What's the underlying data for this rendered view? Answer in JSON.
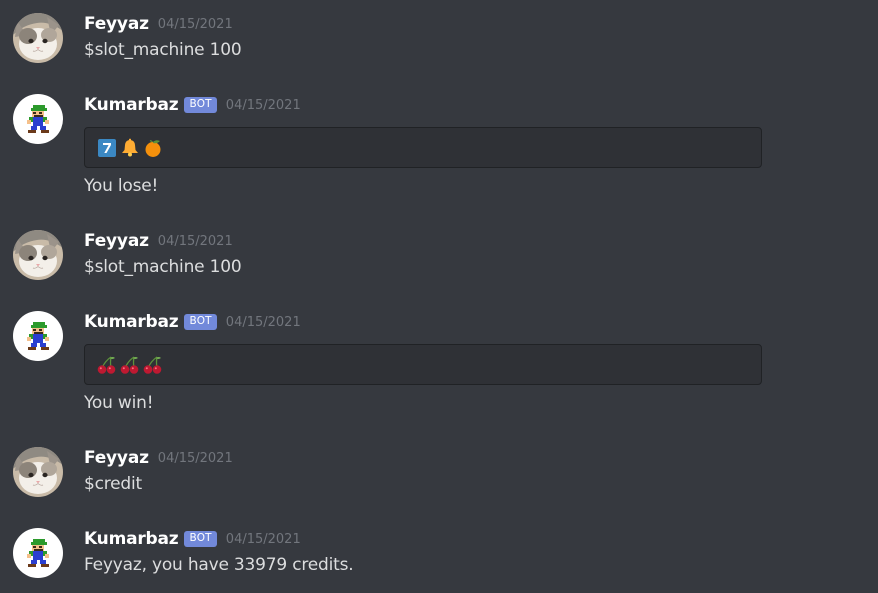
{
  "messages": [
    {
      "author": "Feyyaz",
      "timestamp": "04/15/2021",
      "text": "$slot_machine 100"
    },
    {
      "author": "Kumarbaz",
      "badge": "BOT",
      "timestamp": "04/15/2021",
      "slots": [
        "seven-icon",
        "bell-icon",
        "orange-icon"
      ],
      "text": "You lose!"
    },
    {
      "author": "Feyyaz",
      "timestamp": "04/15/2021",
      "text": "$slot_machine 100"
    },
    {
      "author": "Kumarbaz",
      "badge": "BOT",
      "timestamp": "04/15/2021",
      "slots": [
        "cherries-icon",
        "cherries-icon",
        "cherries-icon"
      ],
      "text": "You win!"
    },
    {
      "author": "Feyyaz",
      "timestamp": "04/15/2021",
      "text": "$credit"
    },
    {
      "author": "Kumarbaz",
      "badge": "BOT",
      "timestamp": "04/15/2021",
      "text": "Feyyaz, you have 33979 credits."
    }
  ],
  "colors": {
    "background": "#36393f",
    "embed_background": "#2f3136",
    "bot_badge": "#7289da",
    "username": "#ffffff",
    "timestamp": "#72767d",
    "text": "#dcddde"
  }
}
